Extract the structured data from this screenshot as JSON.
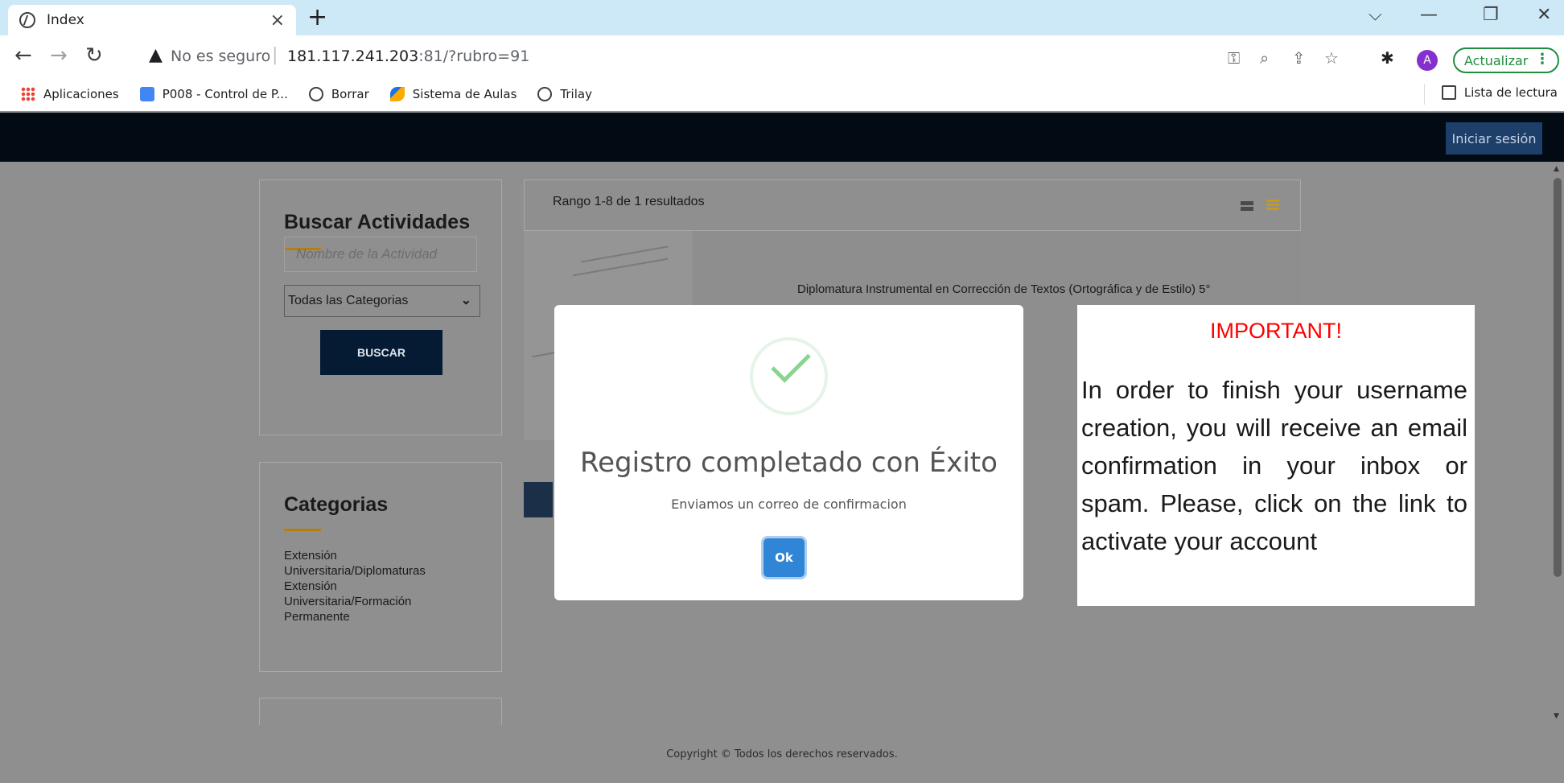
{
  "browser": {
    "tab_title": "Index",
    "tab_close": "×",
    "new_tab": "+",
    "security_label": "No es seguro",
    "url_host": "181.117.241.203",
    "url_rest": ":81/?rubro=91",
    "update_label": "Actualizar",
    "avatar_letter": "A",
    "bookmarks": [
      "Aplicaciones",
      "P008 - Control de P...",
      "Borrar",
      "Sistema de Aulas",
      "Trilay"
    ],
    "reading_list": "Lista de lectura"
  },
  "site": {
    "login_label": "Iniciar sesión",
    "search": {
      "title": "Buscar Actividades",
      "placeholder": "Nombre de la Actividad",
      "category_selected": "Todas las Categorias",
      "button": "BUSCAR"
    },
    "categories": {
      "title": "Categorias",
      "items": [
        "Extensión Universitaria/Diplomaturas",
        "Extensión Universitaria/Formación Permanente"
      ]
    },
    "results_range": "Rango 1-8 de 1 resultados",
    "activity_title": "Diplomatura Instrumental en Corrección de Textos (Ortográfica y de Estilo) 5°",
    "footer": "Copyright © Todos los derechos reservados."
  },
  "modal": {
    "title": "Registro completado con Éxito",
    "subtitle": "Enviamos un correo de confirmacion",
    "ok_label": "Ok"
  },
  "note": {
    "title": "IMPORTANT!",
    "body": "In order to finish your username creation, you will receive an email confirmation in your inbox or spam. Please, click on the link to activate your account"
  },
  "colors": {
    "site_nav": "#020a14",
    "login_button": "#1d3f6a",
    "accent_underline": "#b27f11",
    "modal_ok": "#3085d6",
    "success_check": "#8cd48f",
    "note_title": "#ff0000"
  }
}
